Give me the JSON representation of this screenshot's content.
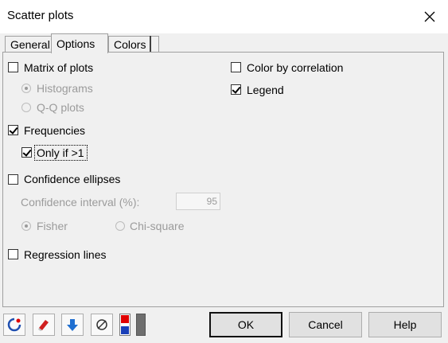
{
  "window": {
    "title": "Scatter plots"
  },
  "tabs": [
    {
      "label": "General",
      "active": false
    },
    {
      "label": "Options",
      "active": true
    },
    {
      "label": "Colors",
      "active": false
    }
  ],
  "options": {
    "matrix_of_plots": {
      "label": "Matrix of plots",
      "checked": false
    },
    "histograms": {
      "label": "Histograms",
      "selected": true,
      "disabled": true
    },
    "qq_plots": {
      "label": "Q-Q plots",
      "selected": false,
      "disabled": true
    },
    "frequencies": {
      "label": "Frequencies",
      "checked": true
    },
    "only_if": {
      "label": "Only if >1",
      "checked": true
    },
    "confidence_ellipses": {
      "label": "Confidence ellipses",
      "checked": false
    },
    "confidence_interval": {
      "label": "Confidence interval (%):",
      "value": "95",
      "disabled": true
    },
    "fisher": {
      "label": "Fisher",
      "selected": true,
      "disabled": true
    },
    "chi_square": {
      "label": "Chi-square",
      "selected": false,
      "disabled": true
    },
    "regression_lines": {
      "label": "Regression lines",
      "checked": false
    },
    "color_by_correlation": {
      "label": "Color by correlation",
      "checked": false
    },
    "legend": {
      "label": "Legend",
      "checked": true
    }
  },
  "toolbar_icons": [
    "reset-icon",
    "eraser-icon",
    "download-arrow-icon",
    "no-selection-icon",
    "colors-icon"
  ],
  "buttons": {
    "ok": "OK",
    "cancel": "Cancel",
    "help": "Help"
  },
  "colors": {
    "accent_red": "#e00000",
    "accent_blue": "#1a3fb8",
    "arrow_blue": "#1f6fd0"
  }
}
